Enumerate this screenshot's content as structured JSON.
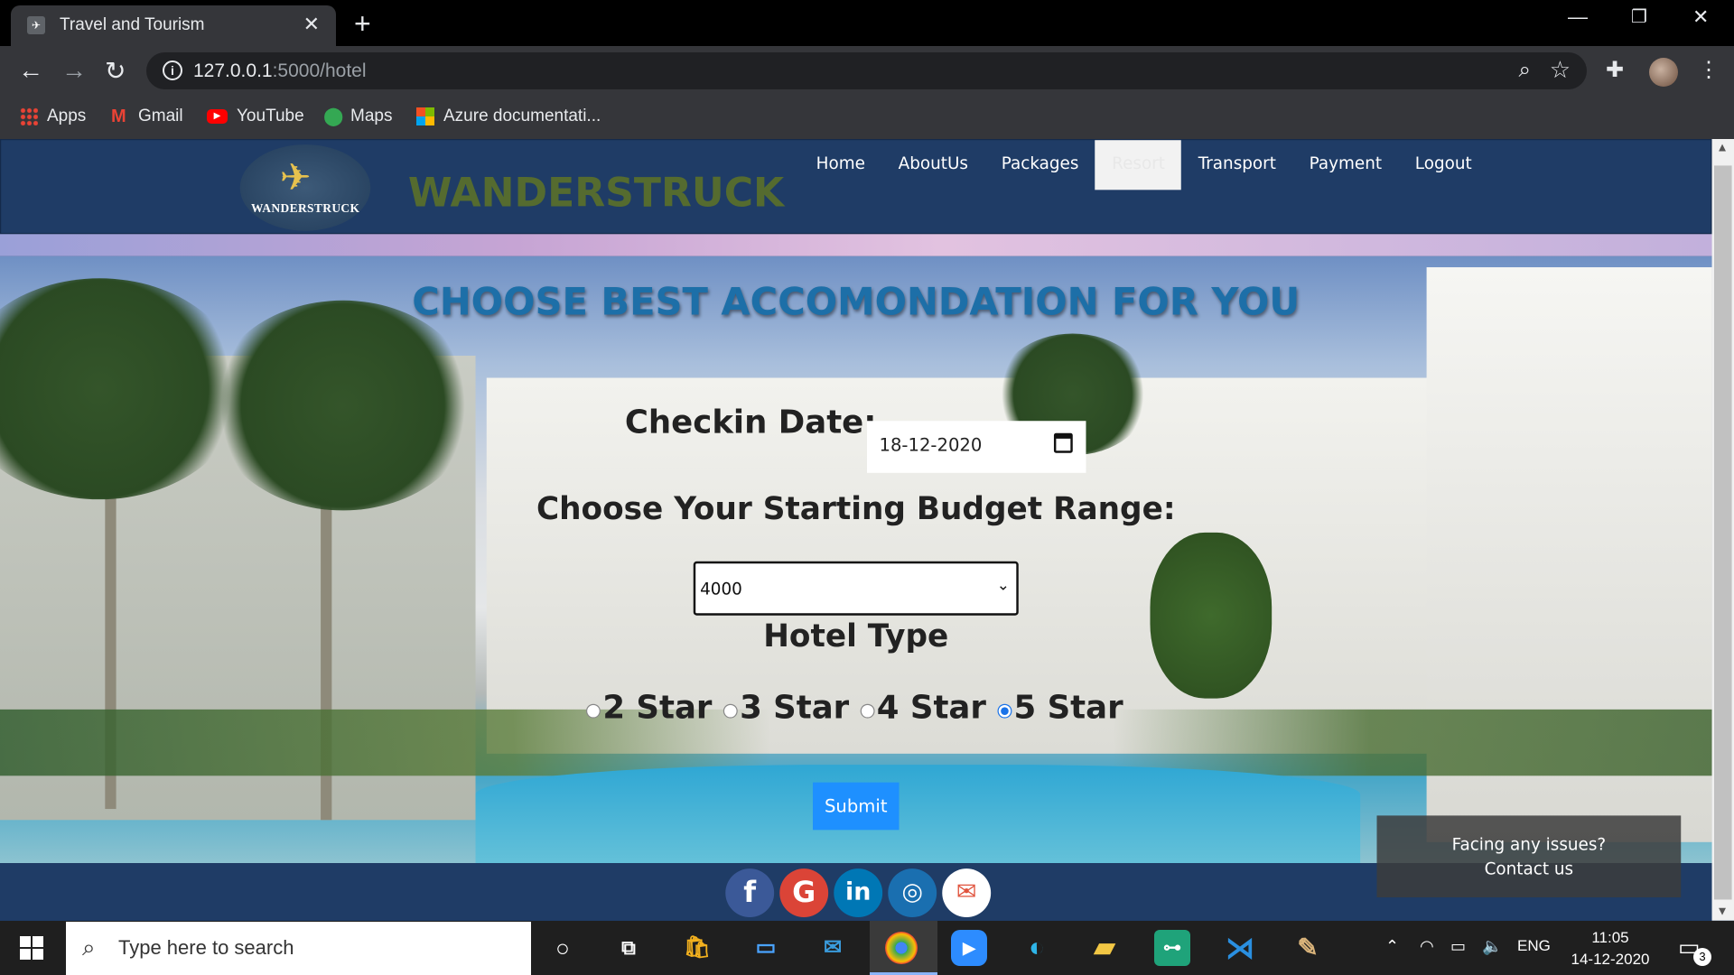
{
  "browser": {
    "tab_title": "Travel and Tourism",
    "tab_close": "✕",
    "new_tab": "+",
    "url_host": "127.0.0.1",
    "url_path": ":5000/hotel",
    "bookmarks": [
      "Apps",
      "Gmail",
      "YouTube",
      "Maps",
      "Azure documentati..."
    ]
  },
  "site": {
    "logo_text": "WANDERSTRUCK",
    "brand": "WANDERSTRUCK",
    "nav": [
      "Home",
      "AboutUs",
      "Packages",
      "Resort",
      "Transport",
      "Payment",
      "Logout"
    ],
    "active_nav": "Resort"
  },
  "form": {
    "heading": "CHOOSE BEST ACCOMONDATION FOR YOU",
    "checkin_label": "Checkin Date:",
    "checkin_value": "18-12-2020",
    "budget_label": "Choose Your Starting Budget Range:",
    "budget_value": "4000",
    "hotel_type_label": "Hotel Type",
    "hotel_types": [
      "2 Star",
      "3 Star",
      "4 Star",
      "5 Star"
    ],
    "selected_hotel_type": "5 Star",
    "submit_label": "Submit"
  },
  "footer": {
    "contact_line1": "Facing any issues?",
    "contact_line2": "Contact us",
    "social": [
      "facebook-icon",
      "google-icon",
      "linkedin-icon",
      "instagram-icon",
      "mail-icon"
    ]
  },
  "taskbar": {
    "search_placeholder": "Type here to search",
    "language": "ENG",
    "time": "11:05",
    "date": "14-12-2020",
    "notification_count": "3"
  },
  "colors": {
    "header_bg": "#1f3c66",
    "brand_text": "#556b2f",
    "heading_text": "#1d6fa8",
    "submit_bg": "#1e90ff"
  }
}
